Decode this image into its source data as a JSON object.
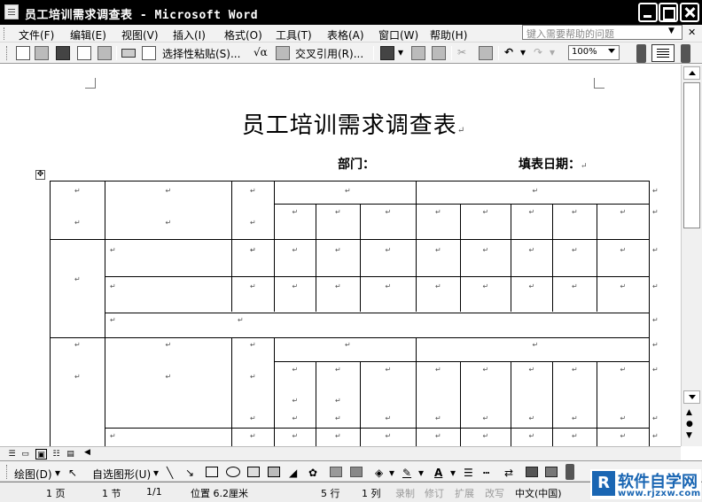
{
  "window": {
    "title": "员工培训需求调查表 - Microsoft Word"
  },
  "menu": {
    "items": [
      "文件(F)",
      "编辑(E)",
      "视图(V)",
      "插入(I)",
      "格式(O)",
      "工具(T)",
      "表格(A)",
      "窗口(W)",
      "帮助(H)"
    ],
    "help_placeholder": "键入需要帮助的问题"
  },
  "toolbar": {
    "paste_special": "选择性粘贴(S)...",
    "cross_reference": "交叉引用(R)...",
    "zoom": "100%"
  },
  "document": {
    "title": "员工培训需求调查表",
    "department_label": "部门：",
    "date_label": "填表日期：",
    "end_mark": "↵"
  },
  "drawbar": {
    "draw_label": "绘图(D)",
    "autoshapes_label": "自选图形(U)"
  },
  "status": {
    "page": "1 页",
    "section": "1 节",
    "page_of": "1/1",
    "position": "位置 6.2厘米",
    "line": "5 行",
    "col": "1 列",
    "rec": "录制",
    "trk": "修订",
    "ext": "扩展",
    "ovr": "改写",
    "lang": "中文(中国)"
  },
  "watermark": {
    "logo_letter": "R",
    "text": "软件自学网",
    "url": "www.rjzxw.com"
  },
  "colors": {
    "titlebar": "#000000",
    "logo": "#1a66b3"
  }
}
